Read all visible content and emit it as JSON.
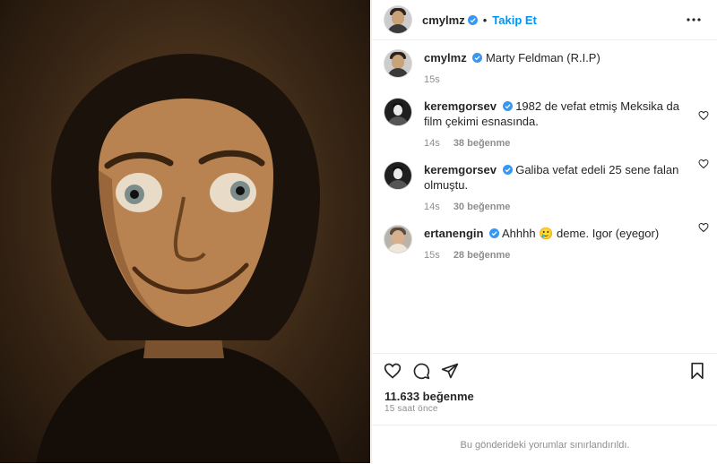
{
  "post": {
    "author": "cmylmz",
    "follow_label": "Takip Et",
    "dot": "•",
    "caption_author": "cmylmz",
    "caption_text": "Marty Feldman (R.I.P)",
    "caption_time": "15s",
    "likes_total": "11.633 beğenme",
    "time_ago": "15 saat önce",
    "comments_disabled_text": "Bu gönderideki yorumlar sınırlandırıldı."
  },
  "comments": [
    {
      "user": "keremgorsev",
      "text": "1982 de vefat etmiş Meksika da film çekimi esnasında.",
      "time": "14s",
      "likes": "38 beğenme"
    },
    {
      "user": "keremgorsev",
      "text": "Galiba vefat edeli 25 sene falan olmuştu.",
      "time": "14s",
      "likes": "30 beğenme"
    },
    {
      "user": "ertanengin",
      "text": "Ahhhh 🥲 deme. Igor (eyegor)",
      "time": "15s",
      "likes": "28 beğenme"
    }
  ],
  "colors": {
    "link": "#0095f6",
    "verified": "#3897f0",
    "muted": "#8e8e8e",
    "text": "#262626"
  },
  "icons": [
    "more-options-icon",
    "heart-icon",
    "comment-icon",
    "share-icon",
    "bookmark-icon",
    "verified-badge-icon"
  ]
}
